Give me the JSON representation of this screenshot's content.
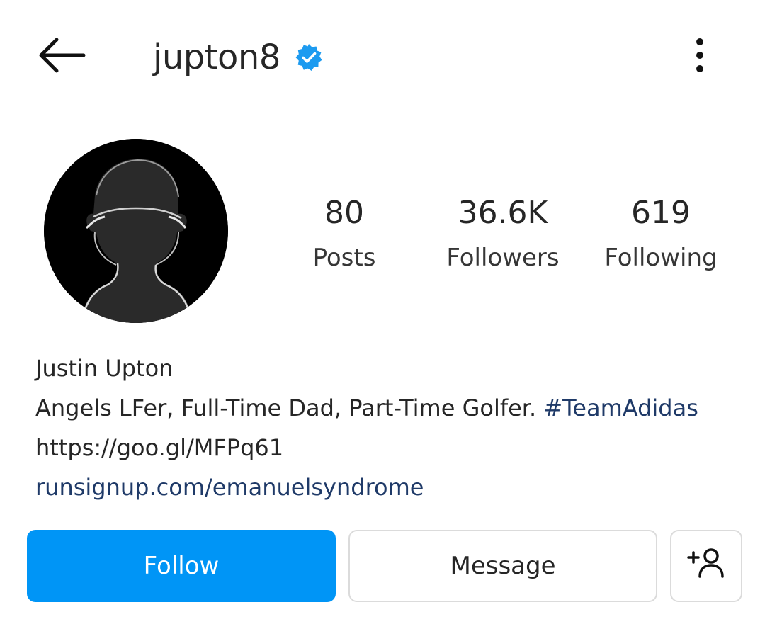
{
  "header": {
    "back_icon": "arrow-left-icon",
    "username": "jupton8",
    "verified_icon": "verified-badge-icon",
    "more_icon": "more-vertical-icon"
  },
  "profile": {
    "avatar": "avatar",
    "stats": {
      "posts": {
        "value": "80",
        "label": "Posts"
      },
      "followers": {
        "value": "36.6K",
        "label": "Followers"
      },
      "following": {
        "value": "619",
        "label": "Following"
      }
    }
  },
  "bio": {
    "name": "Justin Upton",
    "text": "Angels LFer, Full-Time Dad, Part-Time Golfer.",
    "hashtag": "#TeamAdidas",
    "link1": "https://goo.gl/MFPq61",
    "link2": "runsignup.com/emanuelsyndrome"
  },
  "actions": {
    "follow_label": "Follow",
    "message_label": "Message",
    "suggest_icon": "add-person-icon"
  },
  "colors": {
    "accent": "#0095f6",
    "verified": "#1d9bf0",
    "link": "#1f3a68",
    "border": "#dbdbdb"
  }
}
